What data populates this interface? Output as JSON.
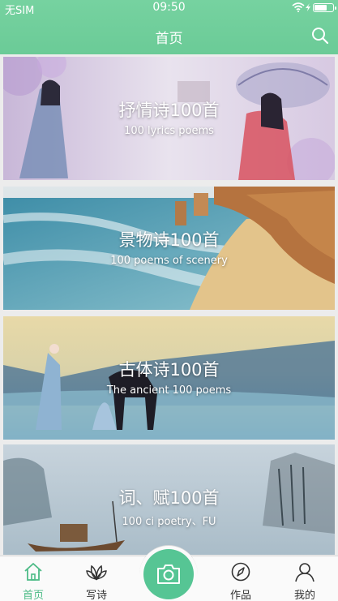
{
  "status_bar": {
    "carrier": "无SIM",
    "time": "09:50",
    "battery_level": 0.7
  },
  "header": {
    "title": "首页",
    "search_icon": "search-icon"
  },
  "cards": [
    {
      "title": "抒情诗100首",
      "subtitle": "100 lyrics poems"
    },
    {
      "title": "景物诗100首",
      "subtitle": "100 poems of scenery"
    },
    {
      "title": "古体诗100首",
      "subtitle": "The ancient 100 poems"
    },
    {
      "title": "词、赋100首",
      "subtitle": "100 ci poetry、FU"
    }
  ],
  "tabbar": {
    "tabs": [
      {
        "label": "首页",
        "icon": "home-icon",
        "active": true
      },
      {
        "label": "写诗",
        "icon": "lotus-icon",
        "active": false
      },
      {
        "label": "作品",
        "icon": "compass-icon",
        "active": false
      },
      {
        "label": "我的",
        "icon": "user-icon",
        "active": false
      }
    ],
    "center_icon": "camera-icon"
  },
  "colors": {
    "accent": "#6bcb97",
    "active_tab": "#4cbb86",
    "inactive_tab": "#333333"
  }
}
